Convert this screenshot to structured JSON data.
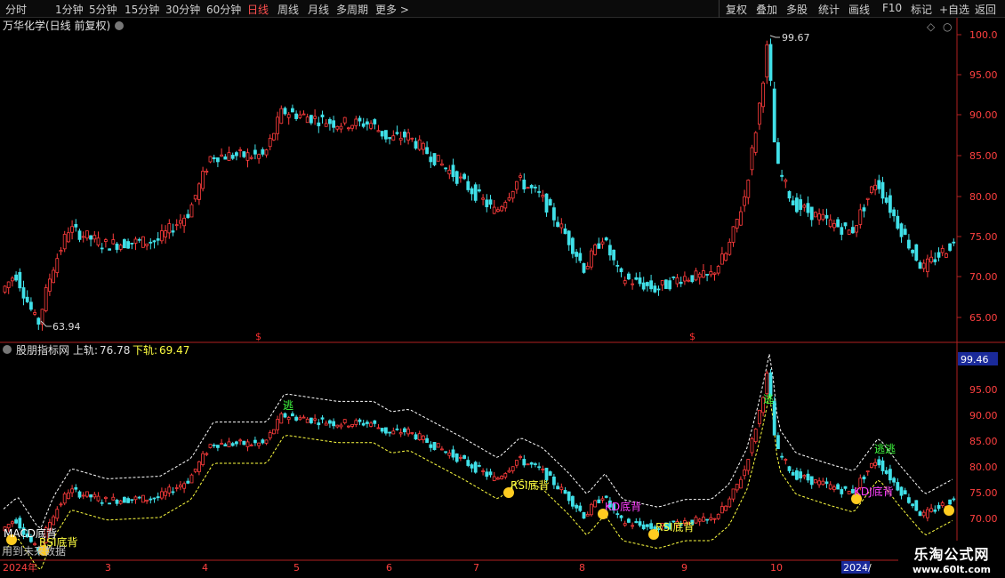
{
  "toolbar": {
    "left": [
      "分时",
      "1分钟",
      "5分钟",
      "15分钟",
      "30分钟",
      "60分钟",
      "日线",
      "周线",
      "月线",
      "多周期",
      "更多 >"
    ],
    "active_index": 6,
    "right": [
      "复权",
      "叠加",
      "多股",
      "统计",
      "画线",
      "F10",
      "标记",
      "+自选",
      "返回"
    ]
  },
  "main_panel": {
    "title": "万华化学(日线 前复权)",
    "price_axis": [
      "100.0",
      "95.00",
      "90.00",
      "85.00",
      "80.00",
      "75.00",
      "70.00",
      "65.00"
    ],
    "high_label": "99.67",
    "low_label": "63.94",
    "marker": "$"
  },
  "indicator_panel": {
    "title": "股朋指标网",
    "upper_label": "上轨:",
    "upper_value": "76.78",
    "lower_label": "下轨:",
    "lower_value": "69.47",
    "price_axis": [
      "95.00",
      "90.00",
      "85.00",
      "80.00",
      "75.00",
      "70.00"
    ],
    "current_price": "99.46",
    "signals": {
      "escape": "逃",
      "escape_double": "逃逃",
      "macd_div": "MACD底背",
      "rsi_div": "RSI底背",
      "kd_div": "KD底背",
      "kdj_div": "KDJ底背"
    },
    "footer_text": "用到未来数据"
  },
  "time_axis": [
    "2024年",
    "3",
    "4",
    "5",
    "6",
    "7",
    "8",
    "9",
    "10",
    "2024/"
  ],
  "watermark": {
    "title": "乐淘公式网",
    "url": "www.60lt.com"
  },
  "colors": {
    "up": "#ff3c3c",
    "down": "#40e0e8",
    "upper_band": "#ffffff",
    "lower_band": "#ffff40",
    "axis": "#b02020",
    "escape": "#40ff40",
    "divergence": "#ffff40",
    "kd": "#ff40ff"
  }
}
